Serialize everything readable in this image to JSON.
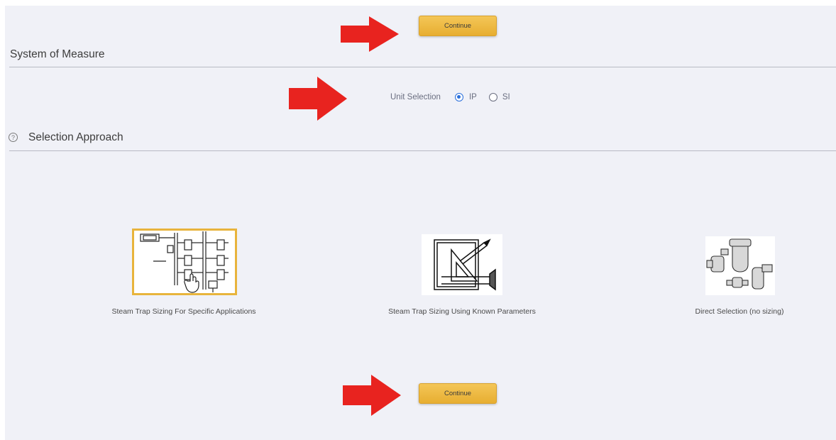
{
  "buttons": {
    "continue_top": "Continue",
    "continue_bottom": "Continue"
  },
  "system_of_measure": {
    "title": "System of Measure"
  },
  "unit_selection": {
    "label": "Unit Selection",
    "options": [
      "IP",
      "SI"
    ],
    "selected": "IP"
  },
  "selection_approach": {
    "title": "Selection Approach",
    "options": [
      {
        "label": "Steam Trap Sizing For Specific Applications",
        "icon": "piping-diagram-icon",
        "selected": true
      },
      {
        "label": "Steam Trap Sizing Using Known Parameters",
        "icon": "drafting-tools-icon",
        "selected": false
      },
      {
        "label": "Direct Selection (no sizing)",
        "icon": "steam-trap-products-icon",
        "selected": false
      }
    ]
  },
  "colors": {
    "accent": "#f0bf4c",
    "arrow": "#e8231f",
    "background": "#f0f1f7"
  }
}
